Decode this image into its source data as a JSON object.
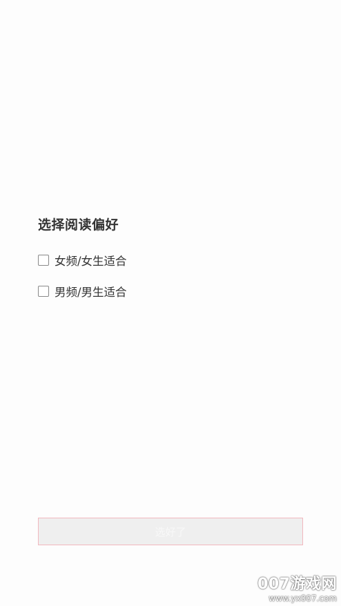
{
  "dialog": {
    "title": "选择阅读偏好",
    "options": [
      {
        "label": "女频/女生适合",
        "checked": false
      },
      {
        "label": "男频/男生适合",
        "checked": false
      }
    ],
    "confirm_label": "选好了"
  },
  "watermark": {
    "brand": "007游戏网",
    "url": "www.yx007.com"
  },
  "colors": {
    "background": "#fdfdfd",
    "button_fill": "#efefef",
    "button_border": "#f2b7be",
    "text": "#333333"
  }
}
